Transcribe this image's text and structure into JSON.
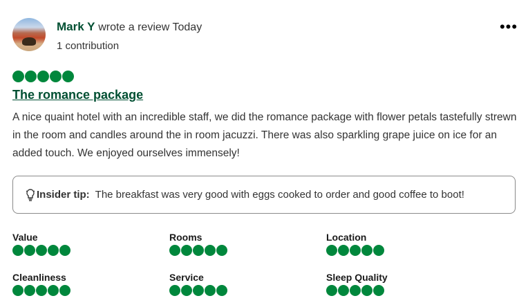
{
  "review": {
    "author": "Mark Y",
    "action": "wrote a review Today",
    "contributions": "1 contribution",
    "rating": 5,
    "title": "The romance package",
    "body": "A nice quaint hotel with an incredible staff, we did the romance package with flower petals tastefully strewn in the room and candles around the in room jacuzzi. There was also sparkling grape juice on ice for an added touch. We enjoyed ourselves immensely!",
    "more_icon": "more-horizontal-icon"
  },
  "tip": {
    "icon": "lightbulb-icon",
    "label": "Insider tip:",
    "text": "The breakfast was very good with eggs cooked to order and good coffee to boot!"
  },
  "subratings": [
    {
      "label": "Value",
      "rating": 5
    },
    {
      "label": "Rooms",
      "rating": 5
    },
    {
      "label": "Location",
      "rating": 5
    },
    {
      "label": "Cleanliness",
      "rating": 5
    },
    {
      "label": "Service",
      "rating": 5
    },
    {
      "label": "Sleep Quality",
      "rating": 5
    }
  ],
  "colors": {
    "bubble": "#00873c",
    "title": "#004f32"
  }
}
